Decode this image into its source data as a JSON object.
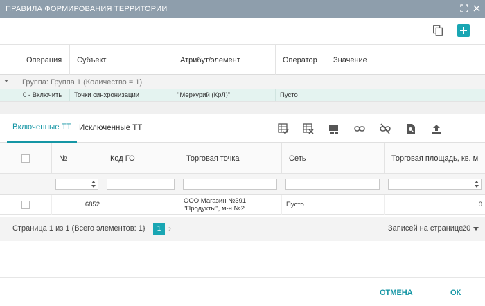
{
  "window": {
    "title": "ПРАВИЛА ФОРМИРОВАНИЯ ТЕРРИТОРИИ"
  },
  "rules": {
    "columns": [
      "Операция",
      "Субъект",
      "Атрибут/элемент",
      "Оператор",
      "Значение"
    ],
    "group_label": "Группа: Группа 1 (Количество = 1)",
    "row": {
      "operation": "0 - Включить",
      "subject": "Точки синхронизации",
      "attribute": "\"Меркурий (КрЛ)\"",
      "operator": "Пусто",
      "value": ""
    }
  },
  "tabs": [
    {
      "label": "Включенные ТТ",
      "active": true
    },
    {
      "label": "Исключенные ТТ",
      "active": false
    }
  ],
  "grid": {
    "columns": [
      "№",
      "Код ГО",
      "Торговая точка",
      "Сеть",
      "Торговая площадь, кв. м"
    ],
    "rows": [
      {
        "num": "6852",
        "code_go": "",
        "store": "ООО Магазин №391 \"Продукты\", м-н №2",
        "network": "Пусто",
        "area": "0"
      }
    ]
  },
  "pager": {
    "info": "Страница 1 из 1 (Всего элементов: 1)",
    "current_page": "1",
    "per_page_label": "Записей на странице:",
    "per_page_value": "20"
  },
  "footer": {
    "cancel": "ОТМЕНА",
    "ok": "ОК"
  },
  "colors": {
    "accent": "#19a6b3",
    "titlebar": "#8e9eac",
    "selected_row": "#e4f3f0"
  }
}
